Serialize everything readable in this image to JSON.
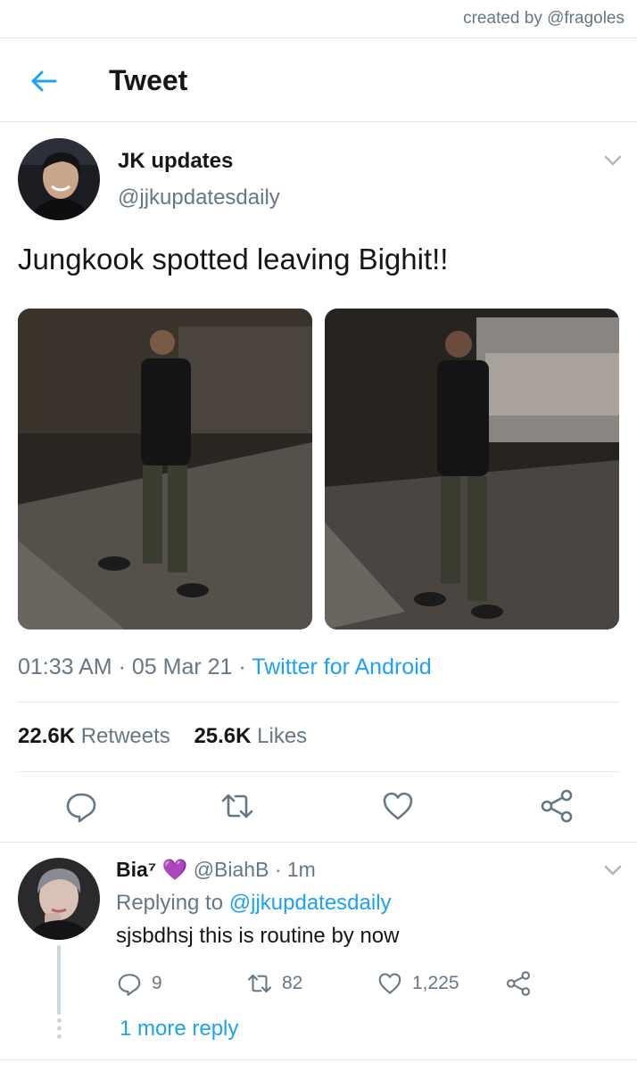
{
  "credit": "created by @fragoles",
  "header": {
    "title": "Tweet"
  },
  "tweet": {
    "author_name": "JK updates",
    "author_handle": "@jjkupdatesdaily",
    "text": "Jungkook spotted leaving Bighit!!",
    "time": "01:33 AM",
    "date": "05 Mar 21",
    "source": "Twitter for Android",
    "retweets_count": "22.6K",
    "retweets_label": "Retweets",
    "likes_count": "25.6K",
    "likes_label": "Likes"
  },
  "reply": {
    "name": "Bia⁷",
    "emoji": "💜",
    "handle": "@BiahB",
    "time": "1m",
    "replying_prefix": "Replying to",
    "replying_to": "@jjkupdatesdaily",
    "text": "sjsbdhsj this is routine by now",
    "reply_count": "9",
    "retweet_count": "82",
    "like_count": "1,225",
    "more_replies": "1 more reply"
  },
  "colors": {
    "accent": "#1da1f2",
    "secondary_text": "#657786",
    "divider": "#e1e8ed",
    "heart": "#7b2fbf"
  },
  "icons": [
    "back-arrow-icon",
    "chevron-down-icon",
    "reply-icon",
    "retweet-icon",
    "like-icon",
    "share-icon"
  ]
}
